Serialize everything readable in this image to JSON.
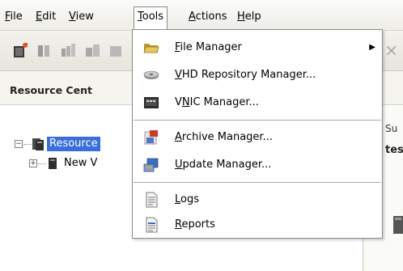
{
  "menubar": {
    "items": [
      {
        "label": "File",
        "mnemonic": "F",
        "rest": "ile"
      },
      {
        "label": "Edit",
        "mnemonic": "E",
        "rest": "dit"
      },
      {
        "label": "View",
        "mnemonic": "V",
        "rest": "iew"
      },
      {
        "label": "Tools",
        "mnemonic": "T",
        "rest": "ools"
      },
      {
        "label": "Actions",
        "mnemonic": "A",
        "rest": "ctions"
      },
      {
        "label": "Help",
        "mnemonic": "H",
        "rest": "elp"
      }
    ]
  },
  "toolbar": {
    "close_glyph": "×"
  },
  "panel": {
    "title": "Resource Cent"
  },
  "tree": {
    "nodes": [
      {
        "label": "Resource",
        "selected": true
      },
      {
        "label": "New V",
        "selected": false
      }
    ]
  },
  "right_pane": {
    "tab_label": "Su",
    "bold_label": "tes"
  },
  "dropdown": {
    "items": [
      {
        "pre": "",
        "u": "F",
        "post": "ile Manager",
        "label": "File Manager",
        "has_submenu": true,
        "icon": "folder-icon"
      },
      {
        "pre": "",
        "u": "V",
        "post": "HD Repository Manager...",
        "label": "VHD Repository Manager...",
        "icon": "disk-icon"
      },
      {
        "pre": "V",
        "u": "N",
        "post": "IC Manager...",
        "label": "VNIC Manager...",
        "icon": "network-card-icon"
      },
      {
        "pre": "",
        "u": "A",
        "post": "rchive Manager...",
        "label": "Archive Manager...",
        "icon": "archive-icon"
      },
      {
        "pre": "",
        "u": "U",
        "post": "pdate Manager...",
        "label": "Update Manager...",
        "icon": "update-icon"
      },
      {
        "pre": "",
        "u": "L",
        "post": "ogs",
        "label": "Logs",
        "icon": "log-document-icon"
      },
      {
        "pre": "",
        "u": "R",
        "post": "eports",
        "label": "Reports",
        "icon": "report-document-icon"
      }
    ],
    "submenu_arrow": "▶"
  },
  "colors": {
    "selection": "#3a6ed8",
    "menu_border": "#8a8a8a",
    "toolbar_icon": "#d24a1f"
  }
}
